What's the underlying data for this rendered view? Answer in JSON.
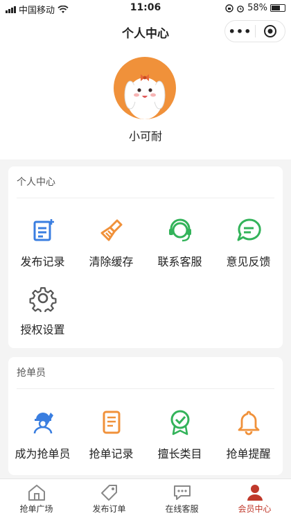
{
  "status_bar": {
    "carrier": "中国移动",
    "time": "11:06",
    "battery": "58%"
  },
  "nav": {
    "title": "个人中心",
    "more": "•••"
  },
  "profile": {
    "username": "小可耐"
  },
  "personal_section": {
    "title": "个人中心",
    "items": [
      {
        "label": "发布记录",
        "icon": "document-add-icon",
        "color": "#3a7ee0"
      },
      {
        "label": "清除缓存",
        "icon": "broom-icon",
        "color": "#f0913a"
      },
      {
        "label": "联系客服",
        "icon": "headset-icon",
        "color": "#33b35a"
      },
      {
        "label": "意见反馈",
        "icon": "chat-bubble-icon",
        "color": "#33b35a"
      },
      {
        "label": "授权设置",
        "icon": "gear-icon",
        "color": "#555555"
      }
    ]
  },
  "grabber_section": {
    "title": "抢单员",
    "items": [
      {
        "label": "成为抢单员",
        "icon": "worker-icon",
        "color": "#3a7ee0"
      },
      {
        "label": "抢单记录",
        "icon": "list-icon",
        "color": "#f0913a"
      },
      {
        "label": "擅长类目",
        "icon": "badge-check-icon",
        "color": "#33b35a"
      },
      {
        "label": "抢单提醒",
        "icon": "bell-icon",
        "color": "#f0913a"
      }
    ]
  },
  "tabbar": {
    "items": [
      {
        "label": "抢单广场",
        "icon": "home-icon",
        "active": false
      },
      {
        "label": "发布订单",
        "icon": "tag-icon",
        "active": false
      },
      {
        "label": "在线客服",
        "icon": "chat-icon",
        "active": false
      },
      {
        "label": "会员中心",
        "icon": "user-icon",
        "active": true
      }
    ],
    "active_color": "#c0392b"
  }
}
